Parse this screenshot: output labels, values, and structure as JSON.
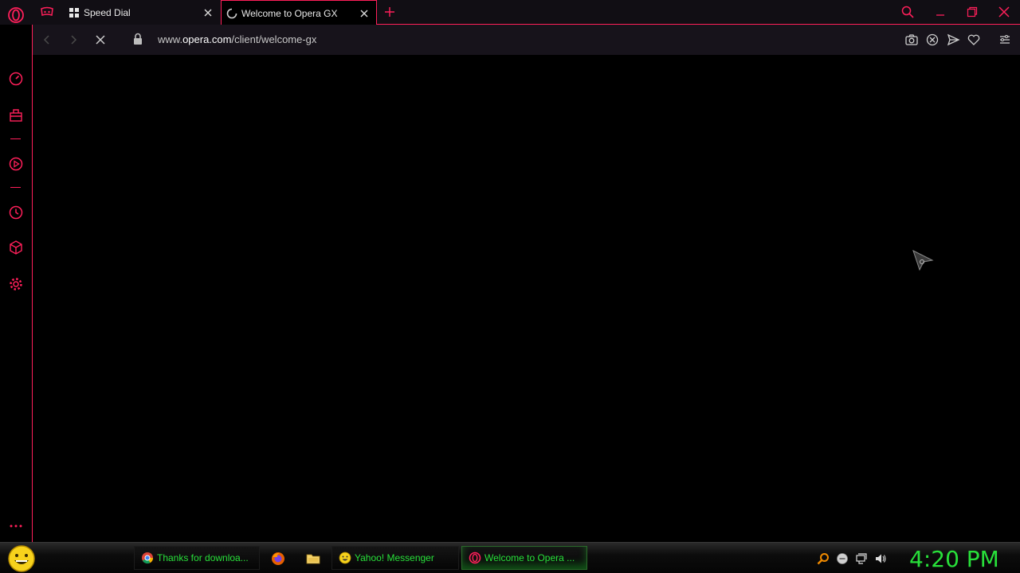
{
  "browser": {
    "accent_color": "#ff1f5a",
    "tabs": [
      {
        "title": "Speed Dial",
        "icon": "grid-icon",
        "active": false
      },
      {
        "title": "Welcome to Opera GX",
        "icon": "loading-spinner-icon",
        "active": true
      }
    ],
    "address": {
      "url_prefix": "www.",
      "url_domain": "opera.com",
      "url_path": "/client/welcome-gx"
    }
  },
  "sidebar": {
    "items": [
      "gx-control-icon",
      "gx-corner-icon",
      "player-icon",
      "history-icon",
      "extensions-icon",
      "settings-icon",
      "more-icon"
    ]
  },
  "taskbar": {
    "items": [
      {
        "label": "Thanks for downloa...",
        "icon": "chrome-icon"
      },
      {
        "label": "Yahoo! Messenger",
        "icon": "yahoo-messenger-icon"
      },
      {
        "label": "Welcome to Opera ...",
        "icon": "opera-icon"
      }
    ],
    "quick_launch": [
      "firefox-icon",
      "folder-icon"
    ],
    "tray": [
      "search-icon",
      "messenger-status-icon",
      "network-icon",
      "volume-icon"
    ],
    "clock": "4:20 PM",
    "text_color": "#28e03a"
  }
}
